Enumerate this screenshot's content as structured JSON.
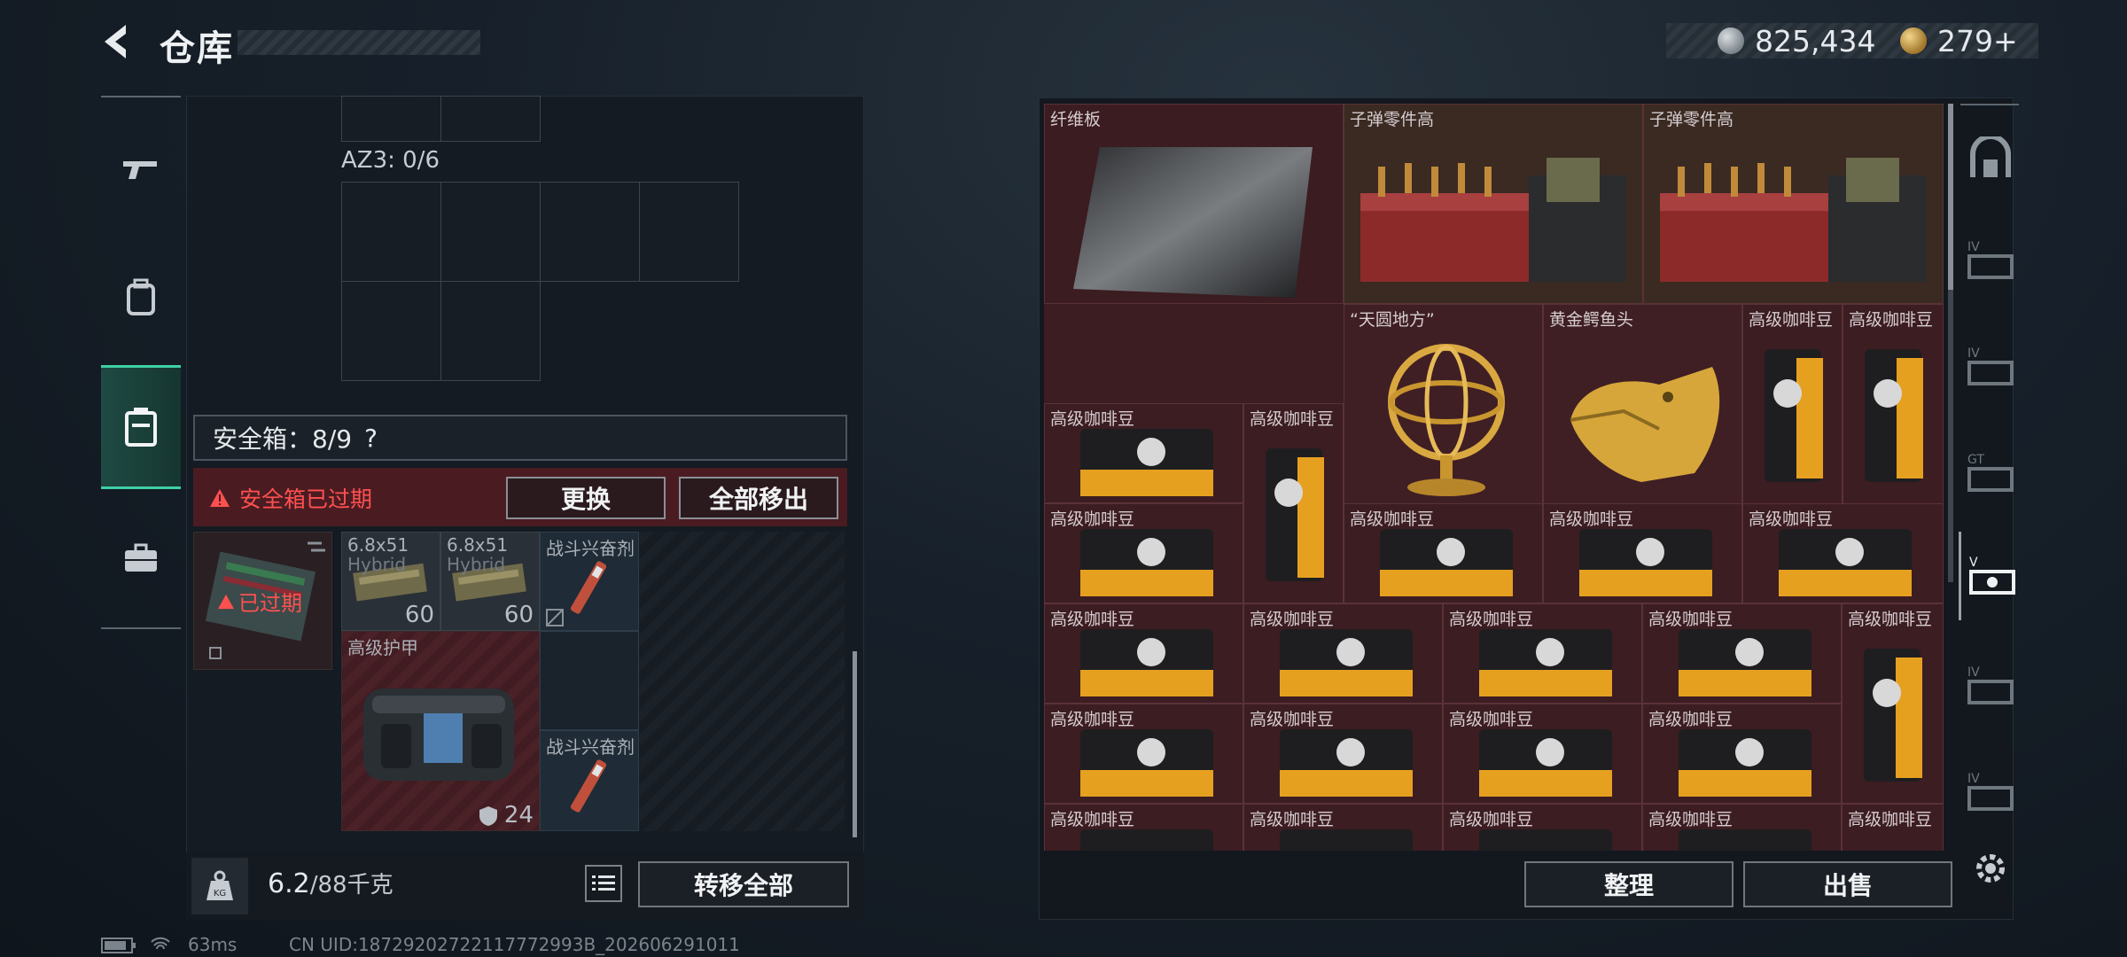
{
  "header": {
    "title": "仓库",
    "silver_amount": "825,434",
    "gold_amount": "279+"
  },
  "left_nav": {
    "items": [
      "gun-tab",
      "backpack-tab",
      "safebox-tab",
      "briefcase-tab"
    ],
    "active": "safebox-tab"
  },
  "container": {
    "az_label": "AZ3: 0/6"
  },
  "safebox": {
    "label": "安全箱：8/9",
    "help": "?",
    "expired_notice": "安全箱已过期",
    "replace_button": "更换",
    "remove_all_button": "全部移出",
    "case_expired_label": "已过期",
    "items": [
      {
        "name": "6.8x51",
        "sub": "Hybrid",
        "qty": "60"
      },
      {
        "name": "6.8x51",
        "sub": "Hybrid",
        "qty": "60"
      },
      {
        "name": "战斗兴奋剂",
        "sub": "",
        "qty": ""
      },
      {
        "name": "高级护甲",
        "sub": "",
        "qty": "24"
      },
      {
        "name": "战斗兴奋剂",
        "sub": "",
        "qty": ""
      }
    ]
  },
  "weight": {
    "current": "6.2",
    "max": "/88千克"
  },
  "transfer_all_button": "转移全部",
  "storage": {
    "items": [
      {
        "name": "纤维板"
      },
      {
        "name": "子弹零件高"
      },
      {
        "name": "子弹零件高"
      },
      {
        "name": "“天圆地方”"
      },
      {
        "name": "黄金鳄鱼头"
      },
      {
        "name": "高级咖啡豆"
      },
      {
        "name": "高级咖啡豆"
      },
      {
        "name": "高级咖啡豆"
      },
      {
        "name": "高级咖啡豆"
      },
      {
        "name": "高级咖啡豆"
      },
      {
        "name": "高级咖啡豆"
      },
      {
        "name": "高级咖啡豆"
      },
      {
        "name": "高级咖啡豆"
      },
      {
        "name": "高级咖啡豆"
      },
      {
        "name": "高级咖啡豆"
      },
      {
        "name": "高级咖啡豆"
      },
      {
        "name": "高级咖啡豆"
      },
      {
        "name": "高级咖啡豆"
      },
      {
        "name": "高级咖啡豆"
      },
      {
        "name": "高级咖啡豆"
      },
      {
        "name": "高级咖啡豆"
      },
      {
        "name": "高级咖啡豆"
      },
      {
        "name": "高级咖啡豆"
      },
      {
        "name": "高级咖啡豆"
      },
      {
        "name": "高级咖啡豆"
      },
      {
        "name": "高级咖啡豆"
      },
      {
        "name": "高级咖啡豆"
      },
      {
        "name": "高级咖啡豆"
      }
    ],
    "organize_button": "整理",
    "sell_button": "出售"
  },
  "right_tabs": [
    "storage-tab-1",
    "storage-tab-2",
    "storage-tab-3",
    "storage-tab-4",
    "storage-tab-5",
    "storage-tab-6",
    "storage-tab-7",
    "settings"
  ],
  "status": {
    "ping": "63ms",
    "uid": "CN UID:18729202722117772993B_202606291011"
  },
  "colors": {
    "accent": "#3fd0a4",
    "expired_red": "#ff5050",
    "item_red_bg": "#4a2127"
  }
}
